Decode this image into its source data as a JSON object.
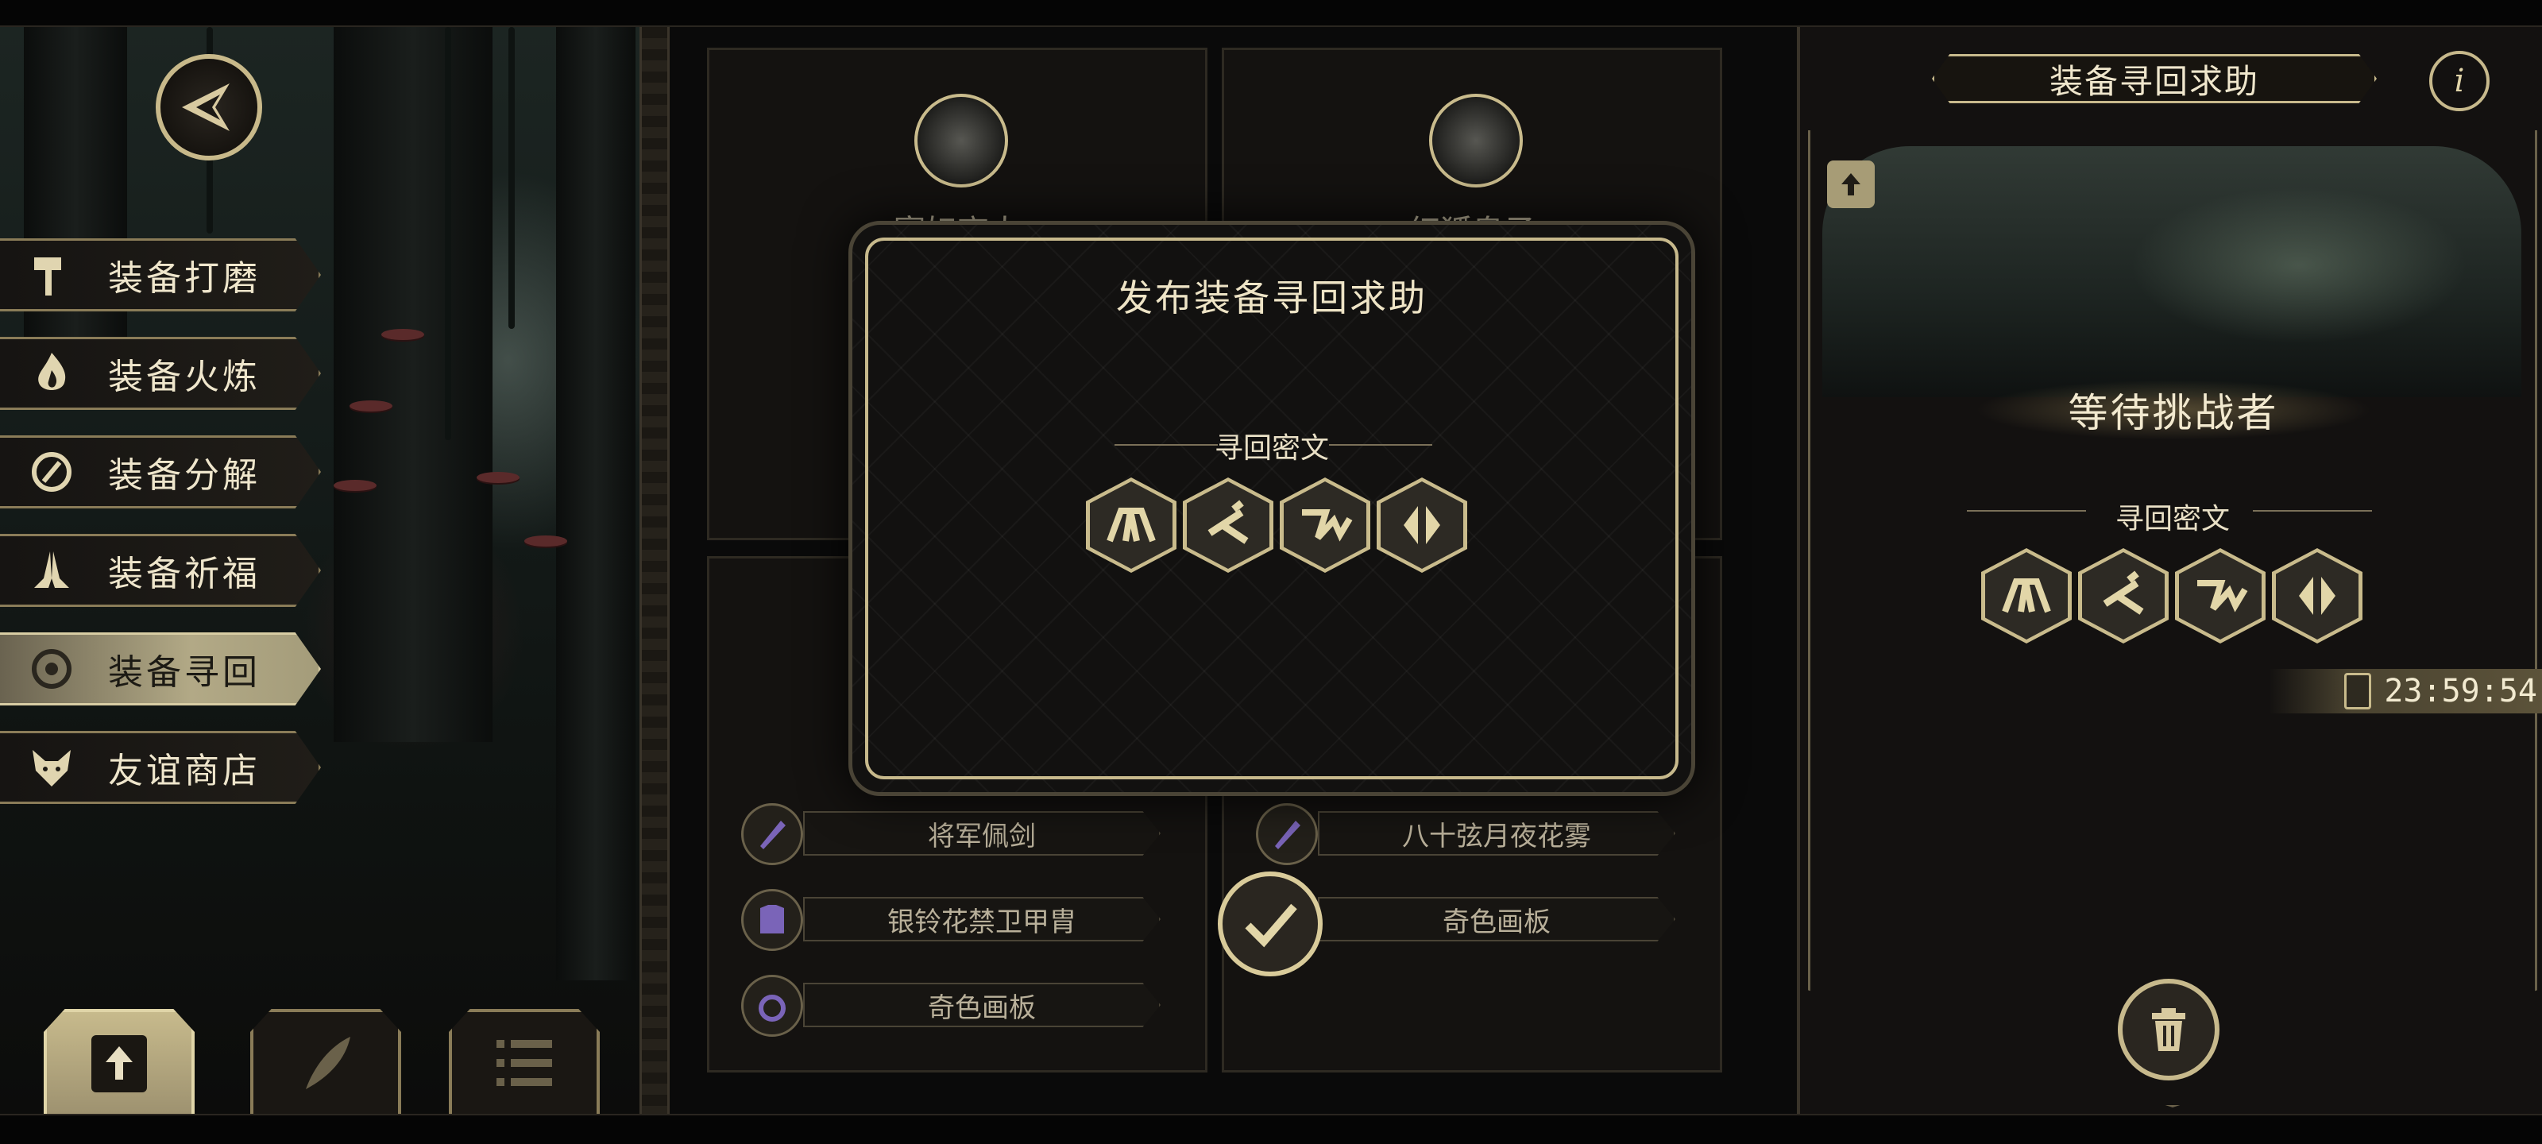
{
  "menu": {
    "items": [
      {
        "label": "装备打磨",
        "icon": "hammer-icon"
      },
      {
        "label": "装备火炼",
        "icon": "flame-icon"
      },
      {
        "label": "装备分解",
        "icon": "decompose-icon"
      },
      {
        "label": "装备祈福",
        "icon": "praying-hands-icon"
      },
      {
        "label": "装备寻回",
        "icon": "target-icon",
        "active": true
      },
      {
        "label": "友谊商店",
        "icon": "fox-icon"
      }
    ]
  },
  "cards": {
    "top_left": {
      "name": "寥妇商人"
    },
    "top_right": {
      "name": "红狐皇子"
    },
    "bottom_left": {
      "items": [
        {
          "label": "将军佩剑",
          "icon": "sword-icon"
        },
        {
          "label": "银铃花禁卫甲胄",
          "icon": "armor-icon"
        },
        {
          "label": "奇色画板",
          "icon": "ring-icon"
        }
      ]
    },
    "bottom_right": {
      "items": [
        {
          "label": "八十弦月夜花雾",
          "icon": "sword-icon"
        },
        {
          "label": "奇色画板",
          "icon": "ring-icon"
        }
      ]
    }
  },
  "modal": {
    "title": "发布装备寻回求助",
    "cipher_label": "寻回密文",
    "runes": [
      "rune-a-icon",
      "rune-b-icon",
      "rune-c-icon",
      "rune-d-icon"
    ]
  },
  "right_panel": {
    "title": "装备寻回求助",
    "status": "等待挑战者",
    "cipher_label": "寻回密文",
    "timer": "23:59:54"
  },
  "colors": {
    "gold": "#c7b98c",
    "panel": "#131110",
    "active_tab": "#b2a986"
  }
}
